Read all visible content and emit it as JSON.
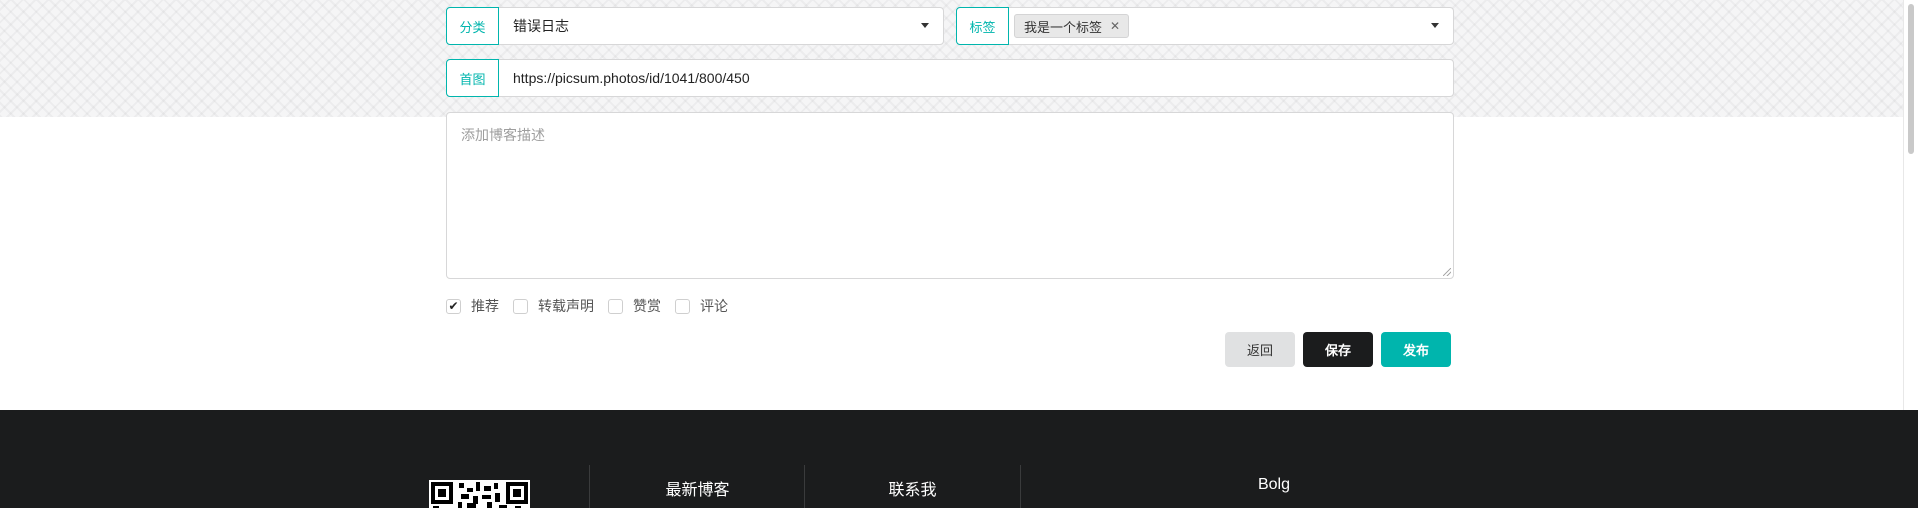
{
  "form": {
    "category": {
      "label": "分类",
      "value": "错误日志"
    },
    "tags": {
      "label": "标签",
      "chip": "我是一个标签",
      "chip_remove": "✕"
    },
    "cover": {
      "label": "首图",
      "value": "https://picsum.photos/id/1041/800/450"
    },
    "description": {
      "placeholder": "添加博客描述"
    },
    "options": [
      {
        "label": "推荐",
        "checked": true
      },
      {
        "label": "转载声明",
        "checked": false
      },
      {
        "label": "赞赏",
        "checked": false
      },
      {
        "label": "评论",
        "checked": false
      }
    ],
    "check_glyph": "✔"
  },
  "actions": {
    "back": "返回",
    "save": "保存",
    "publish": "发布"
  },
  "footer": {
    "latest_blogs": "最新博客",
    "contact": "联系我",
    "brand": "Bolg"
  },
  "colors": {
    "accent": "#00b5ad",
    "dark": "#1b1c1d",
    "neutral": "#e0e1e2"
  },
  "icons": [
    "caret-down-icon",
    "close-icon",
    "check-icon",
    "qr-code-icon"
  ]
}
